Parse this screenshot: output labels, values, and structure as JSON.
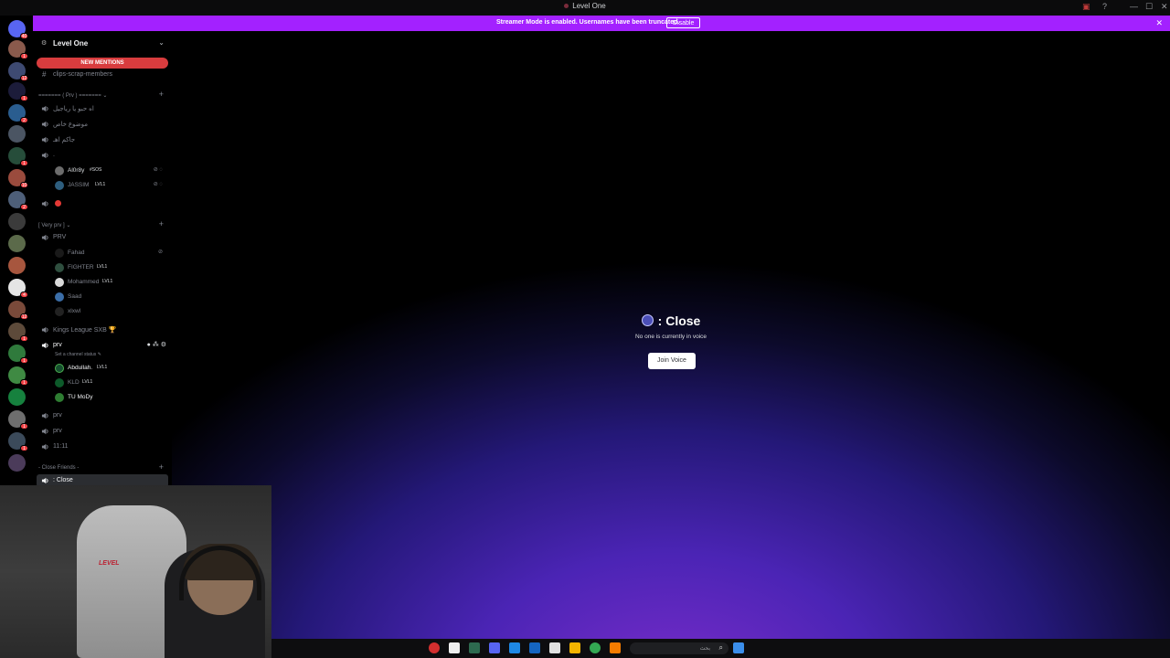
{
  "window": {
    "title": "Level One"
  },
  "banner": {
    "message": "Streamer Mode is enabled. Usernames have been truncated.",
    "disable_label": "Disable"
  },
  "server": {
    "name": "Level One"
  },
  "mentions_label": "NEW MENTIONS",
  "channels_top": [
    {
      "name": "clips-scrap-members"
    }
  ],
  "category_prv": {
    "name": "======= ( Prv ) ======= ⌄"
  },
  "voice_prv": [
    {
      "name": "اه حبو يا رياجيل"
    },
    {
      "name": "موضوع خاص"
    },
    {
      "name": "جاكم اهـ"
    },
    {
      "name": "."
    }
  ],
  "users_a": [
    {
      "name": "Al0r8y",
      "tag": "#SOS"
    },
    {
      "name": "JASSIM",
      "tag": "LVL1"
    }
  ],
  "category_very_prv": {
    "name": "[ Very prv ] ⌄"
  },
  "channel_prv_upper": {
    "name": "PRV"
  },
  "users_prv": [
    {
      "name": "Fahad",
      "tag": ""
    },
    {
      "name": "FIGHTER",
      "tag": "LVL1"
    },
    {
      "name": "Mohammed",
      "tag": "LVL1"
    },
    {
      "name": "Saad",
      "tag": ""
    },
    {
      "name": "xlxwl",
      "tag": ""
    }
  ],
  "channel_kings": {
    "name": "Kings League SXB 🏆"
  },
  "channel_prv_active": {
    "name": "prv",
    "status": "Set a channel status ✎"
  },
  "users_active": [
    {
      "name": "Abdullah.",
      "tag": "LVL1"
    },
    {
      "name": "KLD",
      "tag": "LVL1"
    },
    {
      "name": "TU MoDy",
      "tag": ""
    }
  ],
  "voice_more": [
    {
      "name": "prv"
    },
    {
      "name": "prv"
    },
    {
      "name": "11:11"
    }
  ],
  "category_close": {
    "name": "- Close Friends -"
  },
  "channel_close": {
    "name": ": Close"
  },
  "main": {
    "title": ": Close",
    "subtitle": "No one is currently in voice",
    "join_label": "Join Voice"
  },
  "webcam": {
    "chair_brand": "LEVEL"
  },
  "taskbar": {
    "search_placeholder": "بحث"
  },
  "colors": {
    "banner": "#a321ff",
    "mentions": "#d83c3e",
    "accent": "#5865f2"
  }
}
